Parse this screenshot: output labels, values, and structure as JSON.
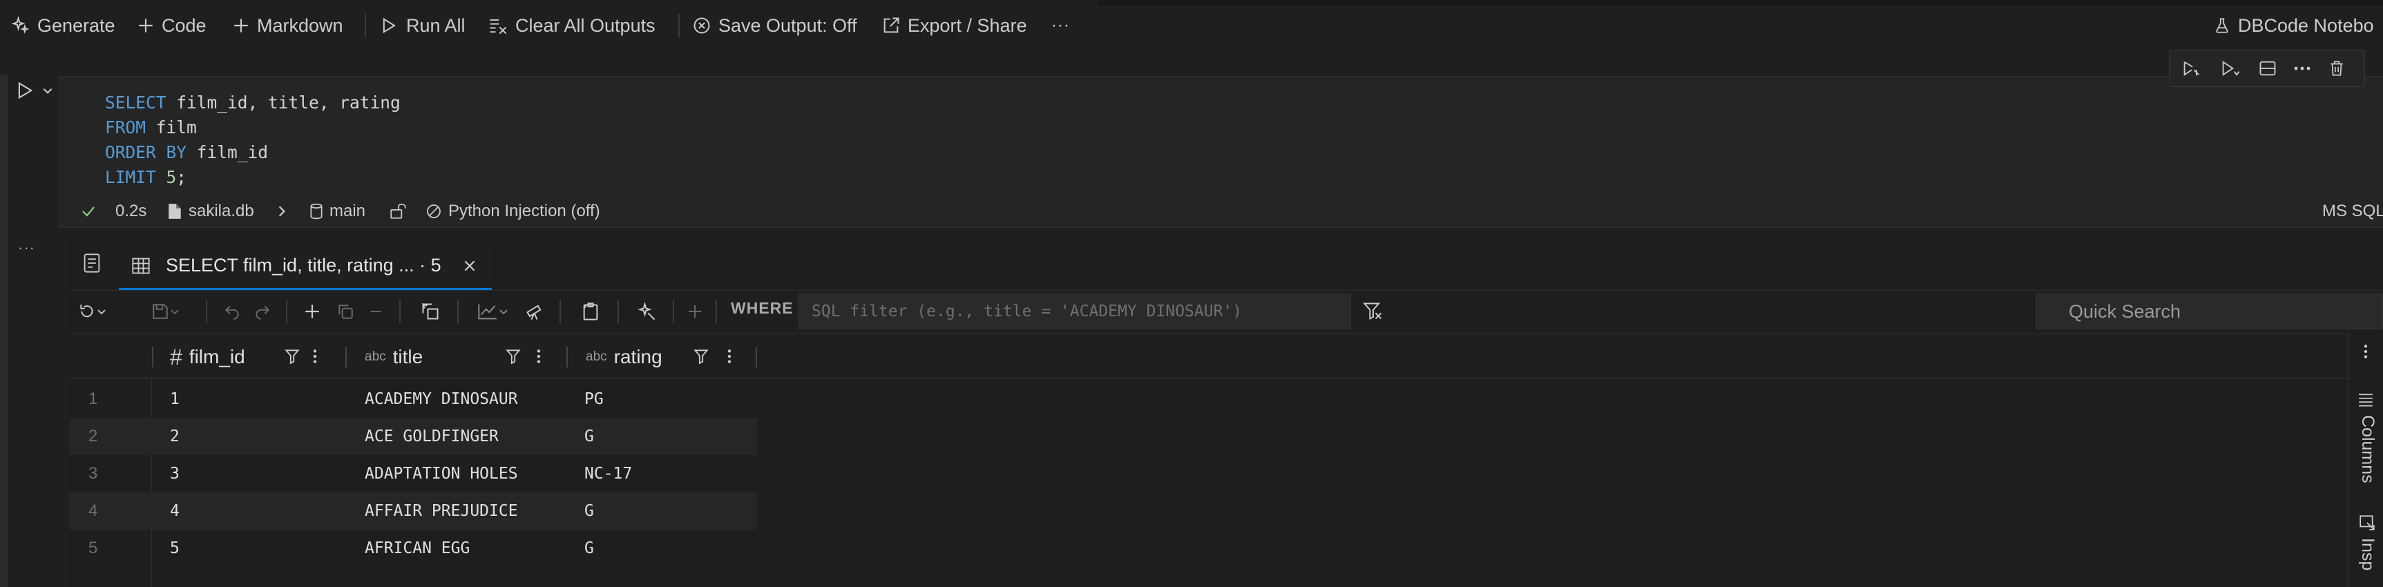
{
  "toolbar": {
    "generate": "Generate",
    "code": "Code",
    "markdown": "Markdown",
    "run_all": "Run All",
    "clear_all_outputs": "Clear All Outputs",
    "save_output": "Save Output: Off",
    "export_share": "Export / Share",
    "more": "···",
    "kernel": "DBCode Notebo"
  },
  "cell": {
    "code": [
      {
        "kw": "SELECT",
        "rest": " film_id, title, rating"
      },
      {
        "kw": "FROM",
        "rest": " film"
      },
      {
        "kw": "ORDER BY",
        "rest": " film_id"
      },
      {
        "kw": "LIMIT",
        "rest": " ",
        "num": "5",
        "tail": ";"
      }
    ],
    "status": {
      "duration": "0.2s",
      "database": "sakila.db",
      "schema": "main",
      "python_injection": "Python Injection (off)",
      "language": "MS SQL"
    }
  },
  "output": {
    "more": "···",
    "tab_label": "SELECT film_id, title, rating ... · 5",
    "where_label": "WHERE",
    "filter_placeholder": "SQL filter (e.g., title = 'ACADEMY DINOSAUR')",
    "quick_search_placeholder": "Quick Search"
  },
  "grid": {
    "columns": [
      {
        "name": "film_id",
        "type_icon": "#"
      },
      {
        "name": "title",
        "type_icon": "abc"
      },
      {
        "name": "rating",
        "type_icon": "abc"
      }
    ],
    "rows": [
      {
        "n": "1",
        "film_id": "1",
        "title": "ACADEMY DINOSAUR",
        "rating": "PG"
      },
      {
        "n": "2",
        "film_id": "2",
        "title": "ACE GOLDFINGER",
        "rating": "G"
      },
      {
        "n": "3",
        "film_id": "3",
        "title": "ADAPTATION HOLES",
        "rating": "NC-17"
      },
      {
        "n": "4",
        "film_id": "4",
        "title": "AFFAIR PREJUDICE",
        "rating": "G"
      },
      {
        "n": "5",
        "film_id": "5",
        "title": "AFRICAN EGG",
        "rating": "G"
      }
    ]
  },
  "side_panel": {
    "columns": "Columns",
    "inspect": "Insp"
  },
  "colors": {
    "background": "#1f1f1f",
    "accent": "#0078d4",
    "keyword": "#569cd6",
    "number": "#b5cea8",
    "success": "#89d185"
  }
}
